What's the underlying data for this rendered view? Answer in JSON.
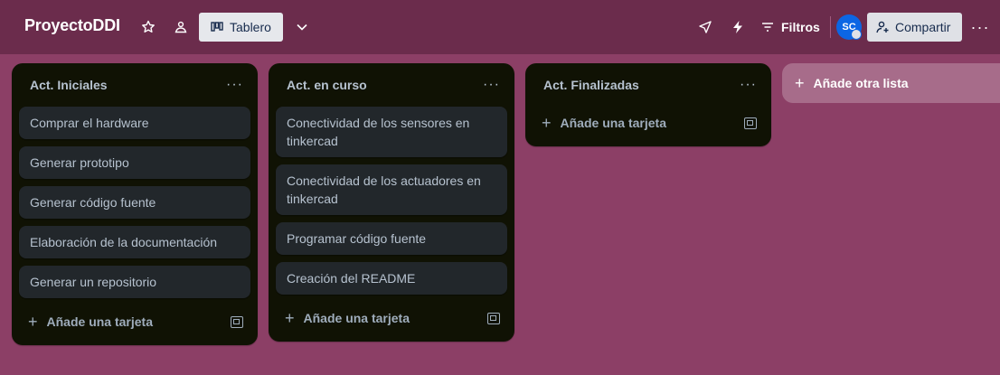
{
  "header": {
    "board_title": "ProyectoDDI",
    "view_label": "Tablero",
    "filters_label": "Filtros",
    "avatar_initials": "SC",
    "share_label": "Compartir"
  },
  "lists": [
    {
      "title": "Act. Iniciales",
      "cards": [
        "Comprar el hardware",
        "Generar prototipo",
        "Generar código fuente",
        "Elaboración de la documentación",
        "Generar un repositorio"
      ],
      "add_label": "Añade una tarjeta"
    },
    {
      "title": "Act. en curso",
      "cards": [
        "Conectividad de los sensores en tinkercad",
        "Conectividad de los actuadores en tinkercad",
        "Programar código fuente",
        "Creación del README"
      ],
      "add_label": "Añade una tarjeta"
    },
    {
      "title": "Act. Finalizadas",
      "cards": [],
      "add_label": "Añade una tarjeta"
    }
  ],
  "add_list_label": "Añade otra lista",
  "colors": {
    "background": "#8c3f66",
    "topbar": "#6b2c4c",
    "list_bg": "#101204",
    "card_bg": "#22272b",
    "avatar": "#0c66e4"
  }
}
